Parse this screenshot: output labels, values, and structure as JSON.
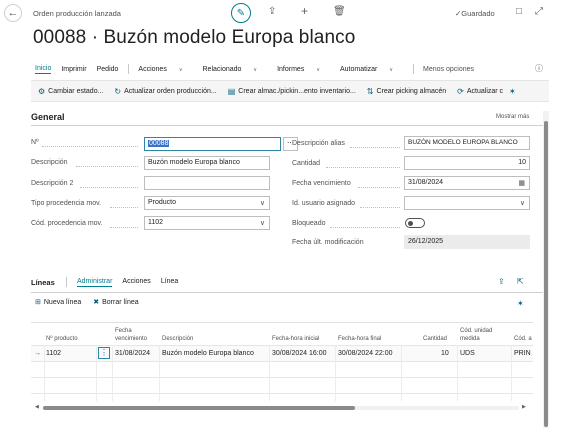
{
  "header": {
    "back_icon": "arrow-left-icon",
    "breadcrumb": "Orden producción lanzada",
    "saved_label": "Guardado",
    "title": "00088 · Buzón modelo Europa blanco"
  },
  "menu": {
    "items": [
      "Inicio",
      "Imprimir",
      "Pedido"
    ],
    "dropdowns": [
      "Acciones",
      "Relacionado",
      "Informes",
      "Automatizar"
    ],
    "fewer": "Menos opciones"
  },
  "actions": [
    "Cambiar estado...",
    "Actualizar orden producción...",
    "Crear almac./pickin...ento inventario...",
    "Crear picking almacén",
    "Actualizar c"
  ],
  "general": {
    "title": "General",
    "show_more": "Mostrar más",
    "left": [
      {
        "label": "Nº",
        "value": "00088"
      },
      {
        "label": "Descripción",
        "value": "Buzón modelo Europa blanco"
      },
      {
        "label": "Descripción 2",
        "value": ""
      },
      {
        "label": "Tipo procedencia mov.",
        "value": "Producto"
      },
      {
        "label": "Cód. procedencia mov.",
        "value": "1102"
      }
    ],
    "right": [
      {
        "label": "Descripción alias",
        "value": "BUZÓN MODELO EUROPA BLANCO"
      },
      {
        "label": "Cantidad",
        "value": "10"
      },
      {
        "label": "Fecha vencimiento",
        "value": "31/08/2024"
      },
      {
        "label": "Id. usuario asignado",
        "value": ""
      },
      {
        "label": "Bloqueado",
        "value": ""
      },
      {
        "label": "Fecha últ. modificación",
        "value": "26/12/2025"
      }
    ]
  },
  "lines": {
    "title": "Líneas",
    "tabs": [
      "Administrar",
      "Acciones",
      "Línea"
    ],
    "new_line": "Nueva línea",
    "delete_line": "Borrar línea",
    "columns": [
      "Nº producto",
      "Fecha vencimiento",
      "Descripción",
      "Fecha-hora inicial",
      "Fecha-hora final",
      "Cantidad",
      "Cód. unidad medida",
      "Cód. a"
    ],
    "rows": [
      {
        "no": "1102",
        "due": "31/08/2024",
        "desc": "Buzón modelo Europa blanco",
        "start": "30/08/2024 16:00",
        "end": "30/08/2024 22:00",
        "qty": "10",
        "uom": "UDS",
        "loc": "PRIN"
      }
    ]
  }
}
